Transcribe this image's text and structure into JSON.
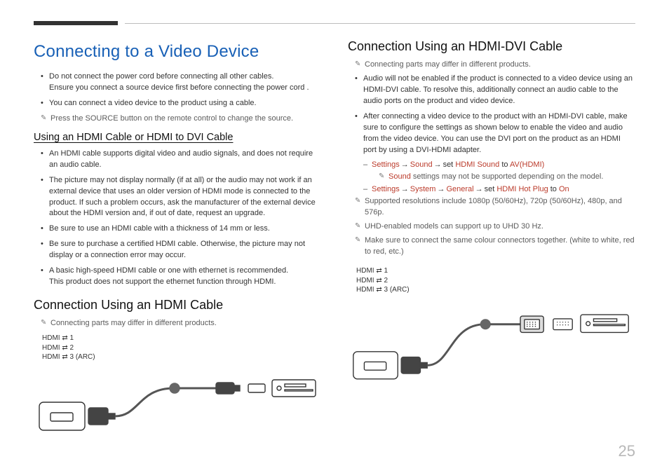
{
  "page_number": "25",
  "left": {
    "title": "Connecting to a Video Device",
    "intro_bullets": [
      "Do not connect the power cord before connecting all other cables.\nEnsure you connect a source device first before connecting the power cord .",
      "You can connect a video device to the product using a cable."
    ],
    "intro_note_prefix": "Press the ",
    "intro_note_button": "SOURCE",
    "intro_note_suffix": " button on the remote control to change the source.",
    "sub1_heading": "Using an HDMI Cable or HDMI to DVI Cable",
    "sub1_bullets": [
      "An HDMI cable supports digital video and audio signals, and does not require an audio cable.",
      "The picture may not display normally (if at all) or the audio may not work if an external device that uses an older version of HDMI mode is connected to the product. If such a problem occurs, ask the manufacturer of the external device about the HDMI version and, if out of date, request an upgrade.",
      "Be sure to use an HDMI cable with a thickness of 14 mm or less.",
      "Be sure to purchase a certified HDMI cable. Otherwise, the picture may not display or a connection error may occur.",
      "A basic high-speed HDMI cable or one with ethernet is recommended.\nThis product does not support the ethernet function through HDMI."
    ],
    "sub2_heading": "Connection Using an HDMI Cable",
    "sub2_note": "Connecting parts may differ in different products.",
    "port_labels": [
      "HDMI ⇄ 1",
      "HDMI ⇄ 2",
      "HDMI ⇄ 3 (ARC)"
    ]
  },
  "right": {
    "heading": "Connection Using an HDMI-DVI Cable",
    "note_top": "Connecting parts may differ in different products.",
    "bullets": [
      "Audio will not be enabled if the product is connected to a video device using an HDMI-DVI cable. To resolve this, additionally connect an audio cable to the audio ports on the product and video device.",
      "After connecting a video device to the product with an HDMI-DVI cable, make sure to configure the settings as shown below to enable the video and audio from the video device. You can use the DVI port on the product as an HDMI port by using a DVI-HDMI adapter."
    ],
    "settings1": {
      "p1": "Settings",
      "p2": "Sound",
      "p3": "set",
      "p4": "HDMI Sound",
      "p5": "to",
      "p6": "AV(HDMI)"
    },
    "settings1_subnote_prefix": "Sound",
    "settings1_subnote_suffix": " settings may not be supported depending on the model.",
    "settings2": {
      "p1": "Settings",
      "p2": "System",
      "p3": "General",
      "p4": "set",
      "p5": "HDMI Hot Plug",
      "p6": "to",
      "p7": "On"
    },
    "notes_tail": [
      "Supported resolutions include 1080p (50/60Hz), 720p (50/60Hz), 480p, and 576p.",
      "UHD-enabled models can support up to UHD 30 Hz.",
      "Make sure to connect the same colour connectors together. (white to white, red to red, etc.)"
    ],
    "port_labels": [
      "HDMI ⇄ 1",
      "HDMI ⇄ 2",
      "HDMI ⇄ 3 (ARC)"
    ]
  }
}
